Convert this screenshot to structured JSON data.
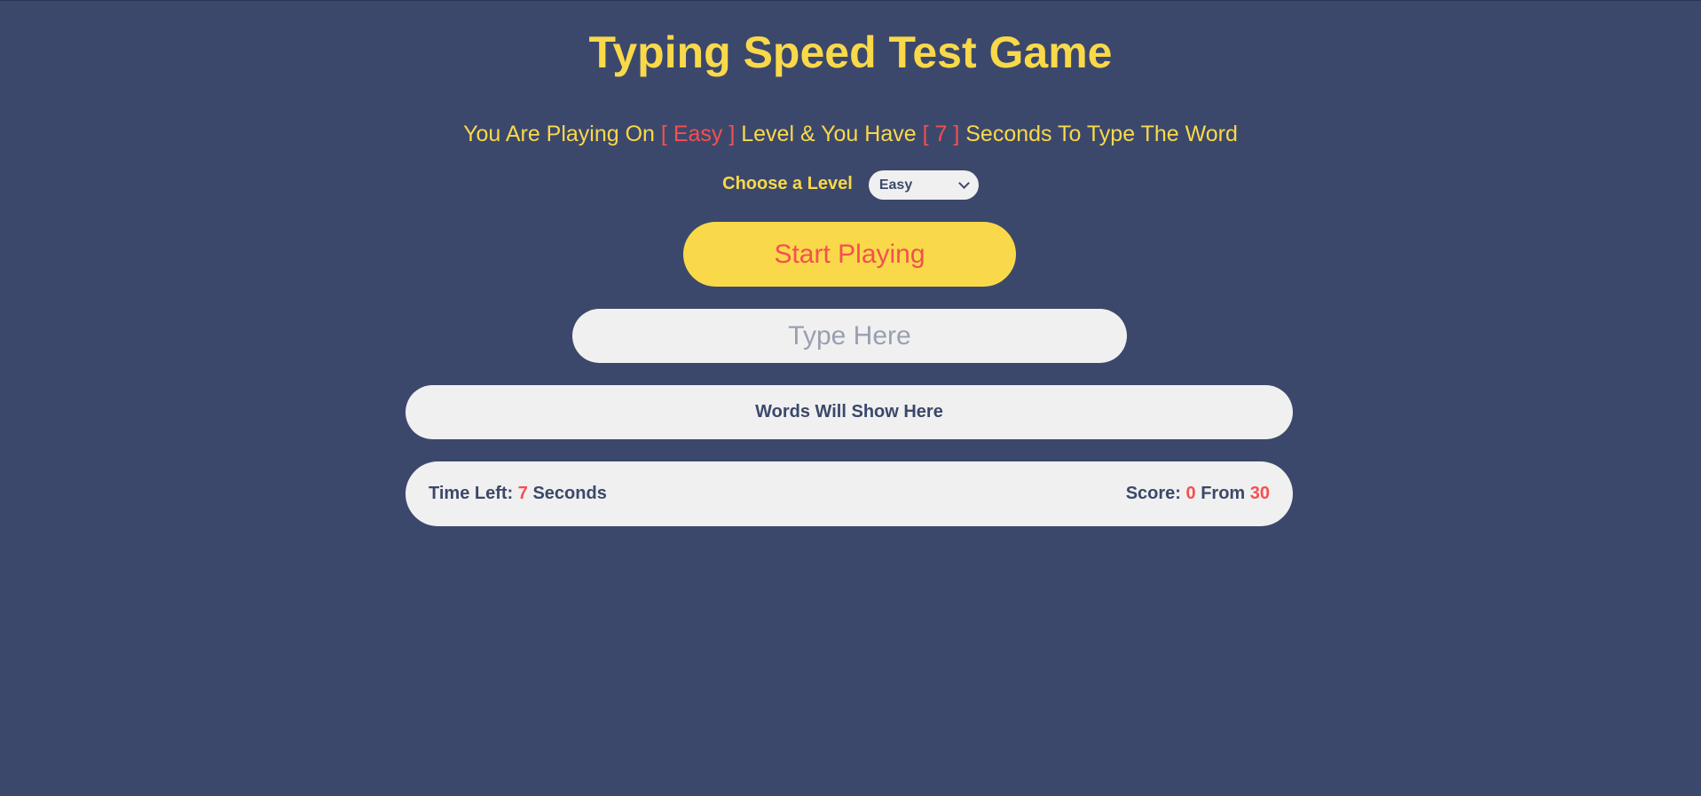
{
  "title": "Typing Speed Test Game",
  "message": {
    "prefix": "You Are Playing On",
    "level": "[ Easy ]",
    "middle": "Level & You Have",
    "seconds": "[ 7 ]",
    "suffix": "Seconds To Type The Word"
  },
  "level_chooser": {
    "label": "Choose a Level",
    "selected": "Easy"
  },
  "start_button": "Start Playing",
  "input": {
    "placeholder": "Type Here",
    "value": ""
  },
  "words_box": "Words Will Show Here",
  "time_left": {
    "label": "Time Left:",
    "value": "7",
    "unit": "Seconds"
  },
  "score": {
    "label": "Score:",
    "got": "0",
    "from_label": "From",
    "total": "30"
  },
  "colors": {
    "background": "#3c486b",
    "accent_yellow": "#f9d949",
    "accent_red": "#f45050",
    "panel": "#f0f0f0"
  }
}
